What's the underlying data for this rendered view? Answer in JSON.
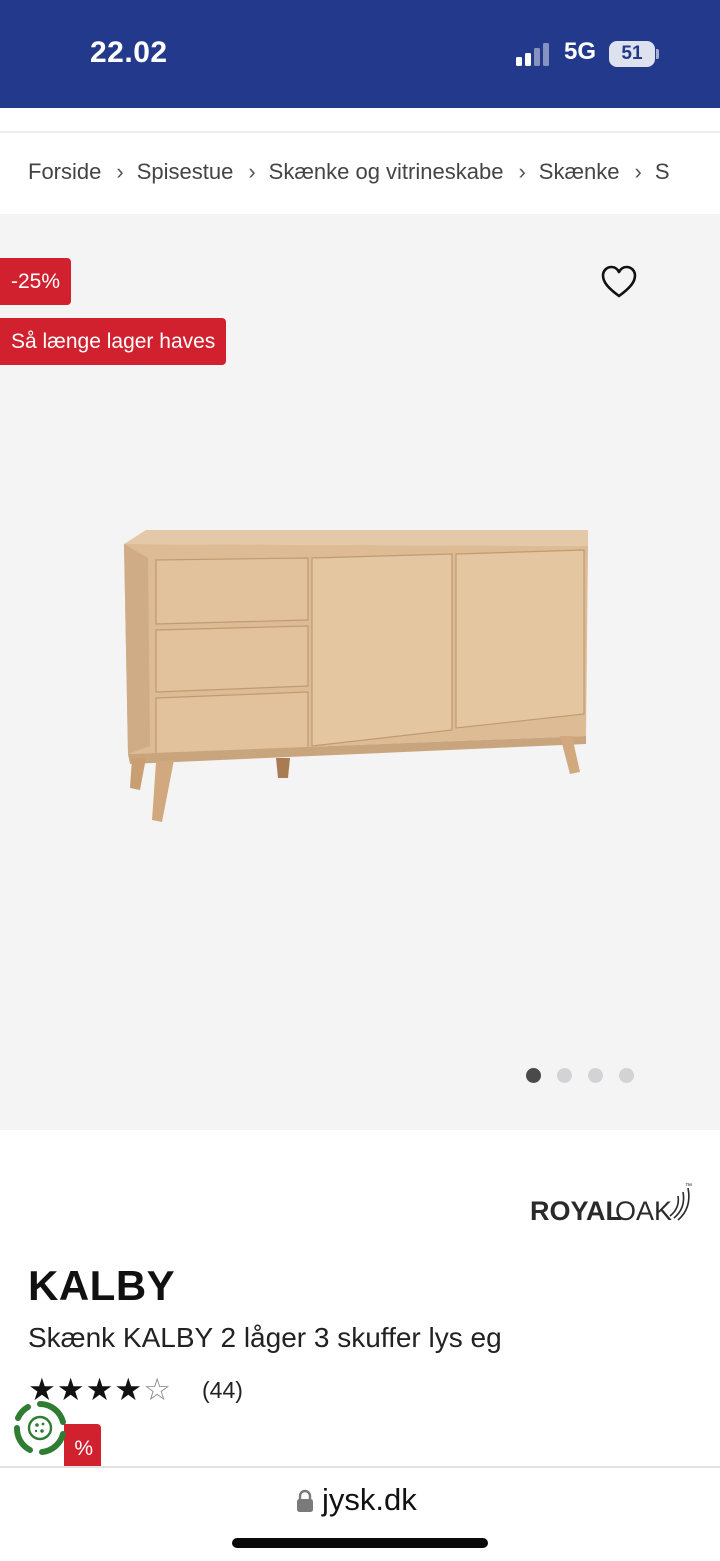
{
  "status_bar": {
    "time": "22.02",
    "network": "5G",
    "battery": "51"
  },
  "breadcrumb": {
    "items": [
      "Forside",
      "Spisestue",
      "Skænke og vitrineskabe",
      "Skænke",
      "S"
    ],
    "separator": "›"
  },
  "gallery": {
    "badges": {
      "discount": "-25%",
      "stock": "Så længe lager haves"
    },
    "wishlist_icon": "heart-outline-icon",
    "image_count": 4,
    "active_image_index": 0,
    "background_color": "#f4f4f5"
  },
  "product": {
    "brand_logo_text": {
      "bold": "ROYAL",
      "light": "OAK",
      "mark": "™"
    },
    "name": "KALBY",
    "subtitle": "Skænk KALBY 2 låger 3 skuffer lys eg",
    "rating": {
      "stars": 4,
      "max_stars": 5,
      "star_full": "★",
      "star_empty": "☆",
      "review_count": "(44)"
    },
    "bottom_badge": "%"
  },
  "browser": {
    "url": "jysk.dk",
    "lock_icon": "lock-icon"
  },
  "colors": {
    "brand_blue": "#233a8c",
    "badge_red": "#d1212f",
    "cookie_green": "#2e7d32"
  }
}
